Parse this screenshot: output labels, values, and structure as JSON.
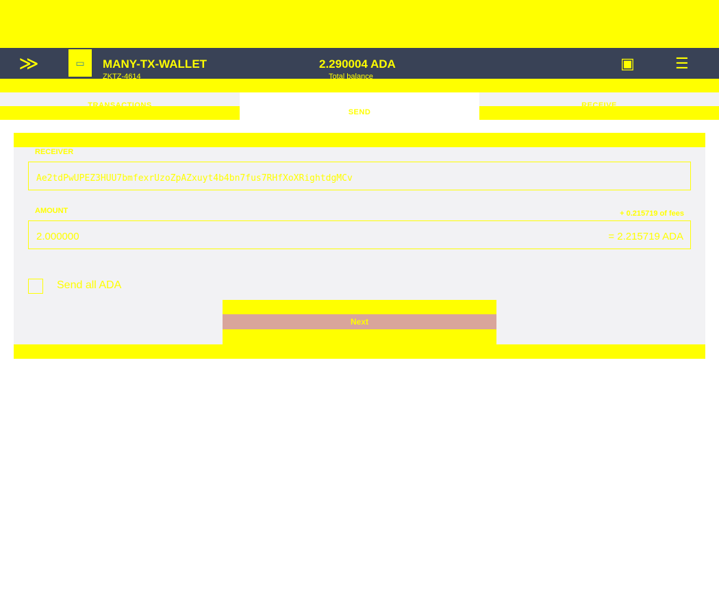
{
  "banner": {
    "line1": "",
    "line2": ""
  },
  "wallet": {
    "name": "MANY-TX-WALLET",
    "subtitle": "ZKTZ-4614",
    "balance": "2.290004 ADA",
    "balance_label": "Total balance"
  },
  "tabs": [
    {
      "label": "TRANSACTIONS",
      "active": false
    },
    {
      "label": "SEND",
      "active": true
    },
    {
      "label": "RECEIVE",
      "active": false
    }
  ],
  "form": {
    "receiver_label": "RECEIVER",
    "receiver_value": "Ae2tdPwUPEZ3HUU7bmfexrUzoZpAZxuyt4b4bn7fus7RHfXoXRightdgMCv",
    "amount_label": "AMOUNT",
    "fees_text": "+ 0.215719 of fees",
    "amount_value": "2.000000",
    "total_text": "= 2.215719 ADA",
    "send_all_label": "Send all ADA",
    "send_all_checked": false,
    "next_label": "Next"
  },
  "colors": {
    "header": "#394256",
    "highlight": "#ffff00",
    "button": "#d9a59b"
  }
}
